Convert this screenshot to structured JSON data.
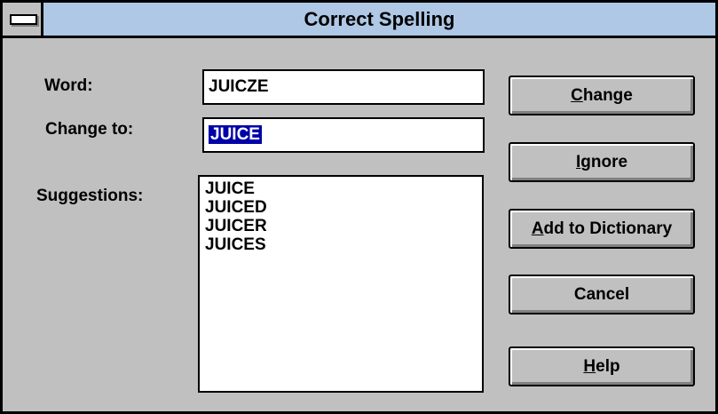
{
  "window": {
    "title": "Correct Spelling"
  },
  "labels": {
    "word": "Word:",
    "change_to": "Change to:",
    "suggestions": "Suggestions:"
  },
  "fields": {
    "word_value": "JUICZE",
    "change_to_value": "JUICE"
  },
  "suggestions": [
    "JUICE",
    "JUICED",
    "JUICER",
    "JUICES"
  ],
  "buttons": {
    "change": {
      "mnemonic": "C",
      "rest": "hange"
    },
    "ignore": {
      "mnemonic": "I",
      "rest": "gnore"
    },
    "add": {
      "mnemonic": "A",
      "rest": "dd to Dictionary"
    },
    "cancel": {
      "label": "Cancel"
    },
    "help": {
      "mnemonic": "H",
      "rest": "elp"
    }
  },
  "colors": {
    "titlebar": "#aec8e6",
    "face": "#c0c0c0",
    "selection": "#0000a8"
  }
}
